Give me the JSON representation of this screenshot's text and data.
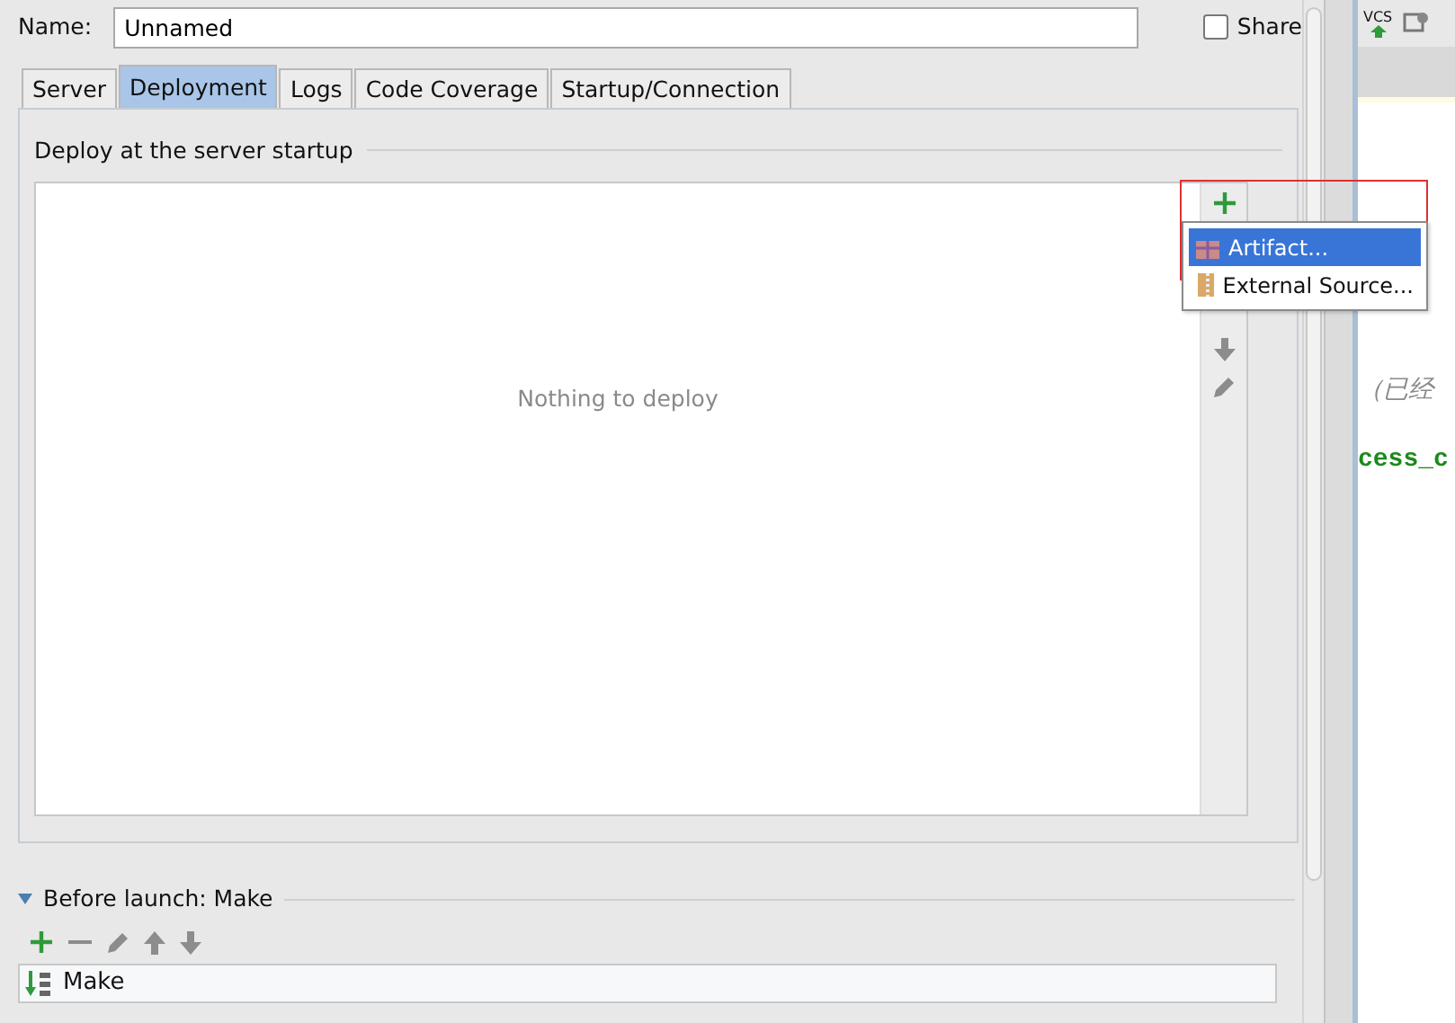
{
  "name_field": {
    "label": "Name:",
    "value": "Unnamed"
  },
  "share": {
    "label": "Share",
    "checked": false
  },
  "tabs": [
    {
      "label": "Server",
      "selected": false
    },
    {
      "label": "Deployment",
      "selected": true
    },
    {
      "label": "Logs",
      "selected": false
    },
    {
      "label": "Code Coverage",
      "selected": false
    },
    {
      "label": "Startup/Connection",
      "selected": false
    }
  ],
  "deploy": {
    "title": "Deploy at the server startup",
    "empty_text": "Nothing to deploy"
  },
  "add_menu": {
    "items": [
      {
        "label": "Artifact...",
        "selected": true,
        "kind": "artifact"
      },
      {
        "label": "External Source...",
        "selected": false,
        "kind": "external"
      }
    ]
  },
  "before_launch": {
    "title": "Before launch: Make",
    "expanded": true,
    "tasks": [
      {
        "label": "Make"
      }
    ]
  },
  "editor": {
    "toolbar_label": "VCS",
    "lines": [
      {
        "text": "（已经",
        "kind": "comment"
      },
      {
        "text": "cess_c",
        "kind": "code"
      }
    ]
  }
}
